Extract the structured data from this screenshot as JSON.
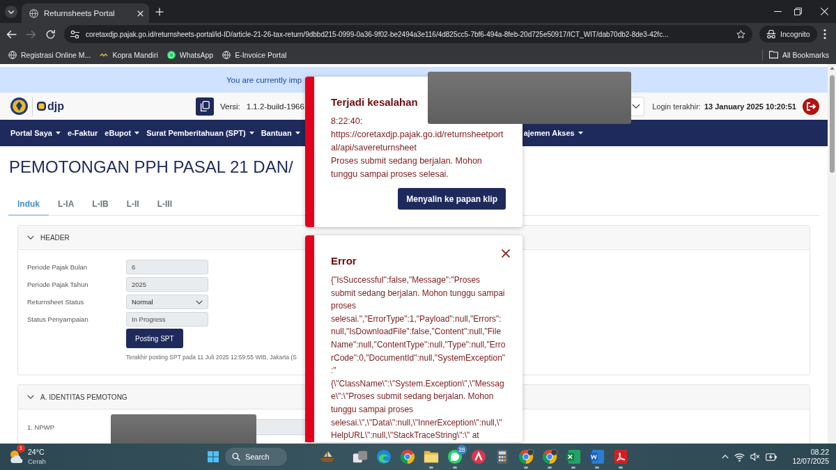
{
  "browser": {
    "tabs": [
      {
        "title": "Returnsheets Portal",
        "selected": true
      }
    ],
    "back_enabled": true,
    "forward_enabled": false,
    "url": "coretaxdjp.pajak.go.id/returnsheets-portal/id-ID/article-21-26-tax-return/9dbbd215-0999-0a36-9f02-be2494a3e116/4d825cc5-7bf6-494a-8feb-20d725e50917/ICT_WIT/dab70db2-8de3-42fc...",
    "profile": "Incognito",
    "bookmarks": [
      {
        "label": "Registrasi Online M...",
        "kind": "globe"
      },
      {
        "label": "Kopra Mandiri",
        "kind": "dash"
      },
      {
        "label": "WhatsApp",
        "kind": "chat"
      },
      {
        "label": "E-Invoice Portal",
        "kind": "globe"
      }
    ],
    "all_bookmarks": "All Bookmarks"
  },
  "banner": {
    "text": "You are currently imp"
  },
  "header": {
    "logo_text": "djp",
    "version_label": "Versi:",
    "version_value": "1.1.2-build-1966",
    "login_label": "Login terakhir:",
    "login_time": "13 January 2025 10:20:51"
  },
  "nav": [
    {
      "label": "Portal Saya",
      "dropdown": true
    },
    {
      "label": "e-Faktur",
      "dropdown": false
    },
    {
      "label": "eBupot",
      "dropdown": true
    },
    {
      "label": "Surat Pemberitahuan (SPT)",
      "dropdown": true
    },
    {
      "label": "Bantuan",
      "dropdown": true
    },
    {
      "label": "ajemen Akses",
      "dropdown": true
    }
  ],
  "page_title": "PEMOTONGAN PPH PASAL 21 DAN/",
  "tabs": [
    {
      "label": "Induk",
      "selected": true
    },
    {
      "label": "L-IA",
      "selected": false
    },
    {
      "label": "L-IB",
      "selected": false
    },
    {
      "label": "L-II",
      "selected": false
    },
    {
      "label": "L-III",
      "selected": false
    }
  ],
  "sections": [
    {
      "title": "HEADER",
      "expanded": true,
      "fields": [
        {
          "label": "Periode Pajak Bulan",
          "kind": "input",
          "value": "6"
        },
        {
          "label": "Periode Pajak Tahun",
          "kind": "input",
          "value": "2025"
        },
        {
          "label": "Returnsheet Status",
          "kind": "select",
          "value": "Normal"
        },
        {
          "label": "Status Penyampaian",
          "kind": "input",
          "value": "In Progress"
        }
      ],
      "button": "Posting SPT",
      "note": "Terakhir posting SPT pada 11 Juli 2025 12:59:55 WIB, Jakarta (S"
    },
    {
      "title": "A. IDENTITAS PEMOTONG",
      "expanded": true,
      "fields": [
        {
          "label": "1. NPWP",
          "kind": "wide-input"
        }
      ]
    }
  ],
  "toasts": [
    {
      "title": "Terjadi kesalahan",
      "message": "8:22:40: https://coretaxdjp.pajak.go.id/returnsheetportal/api/savereturnsheet\nProses submit sedang berjalan. Mohon tunggu sampai proses selesai.",
      "button": "Menyalin ke papan klip"
    },
    {
      "title": "Error",
      "closable": true,
      "message": "{\"IsSuccessful\":false,\"Message\":\"Proses submit sedang berjalan. Mohon tunggu sampai proses selesai.\",\"ErrorType\":1,\"Payload\":null,\"Errors\":null,\"IsDownloadFile\":false,\"Content\":null,\"FileName\":null,\"ContentType\":null,\"Type\":null,\"ErrorCode\":0,\"DocumentId\":null,\"SystemException\":\"{\\\"ClassName\\\":\\\"System.Exception\\\",\\\"Message\\\":\\\"Proses submit sedang berjalan. Mohon tunggu sampai proses selesai.\\\",\\\"Data\\\":null,\\\"InnerException\\\":null,\\\"HelpURL\\\":null,\\\"StackTraceString\\\":\\\" at"
    }
  ],
  "taskbar": {
    "weather": {
      "badge": "1",
      "temperature": "24°C",
      "condition": "Cerah"
    },
    "search": "Search",
    "apps": [
      {
        "kind": "boat",
        "running": false
      },
      {
        "kind": "squares",
        "running": false
      },
      {
        "kind": "swirl",
        "running": false
      },
      {
        "kind": "browser",
        "running": false
      },
      {
        "kind": "folder",
        "running": true
      },
      {
        "kind": "chat",
        "running": true,
        "badge": "28"
      },
      {
        "kind": "caret",
        "running": false
      },
      {
        "kind": "calculator",
        "running": false
      },
      {
        "kind": "browser-profile",
        "running": true
      },
      {
        "kind": "browser-profile",
        "running": true
      },
      {
        "kind": "spreadsheet",
        "running": true
      },
      {
        "kind": "document",
        "running": true
      },
      {
        "kind": "pdf",
        "running": true
      }
    ],
    "time": "08.22",
    "date": "12/07/2025"
  }
}
